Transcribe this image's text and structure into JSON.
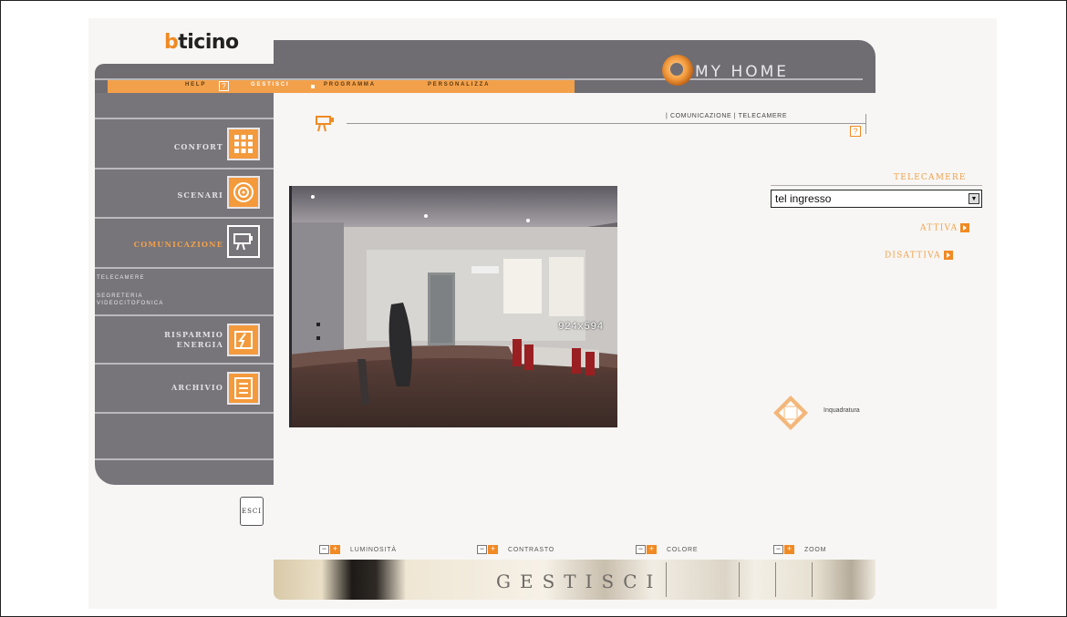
{
  "brand": {
    "logo": "bticino",
    "product": "MY HOME"
  },
  "nav": {
    "help": "HELP",
    "help_icon": "?",
    "items": [
      "GESTISCI",
      "PROGRAMMA",
      "PERSONALIZZA"
    ]
  },
  "sidebar": {
    "items": [
      {
        "label": "CONFORT",
        "icon": "keypad-icon"
      },
      {
        "label": "SCENARI",
        "icon": "scene-dial-icon"
      },
      {
        "label": "COMUNICAZIONE",
        "icon": "camera-icon",
        "active": true
      },
      {
        "label": "RISPARMIO ENERGIA",
        "icon": "energy-icon"
      },
      {
        "label": "ARCHIVIO",
        "icon": "archive-icon"
      }
    ],
    "subitems": [
      "TELECAMERE",
      "SEGRETERIA VIDEOCITOFONICA"
    ],
    "exit": "ESCI"
  },
  "breadcrumb": "| COMUNICAZIONE | TELECAMERE",
  "help_box": "?",
  "video": {
    "resolution": "924x594"
  },
  "panel": {
    "title": "TELECAMERE",
    "camera_select": "tel ingresso",
    "activate": "ATTIVA",
    "deactivate": "DISATTIVA",
    "framing": "Inquadratura"
  },
  "controls": {
    "minus": "−",
    "plus": "+",
    "items": [
      "LUMINOSITÀ",
      "CONTRASTO",
      "COLORE",
      "ZOOM"
    ]
  },
  "footer": {
    "title": "GESTISCI"
  },
  "colors": {
    "accent": "#f08a24",
    "sidebar": "#77757a",
    "header": "#6f6d72"
  }
}
